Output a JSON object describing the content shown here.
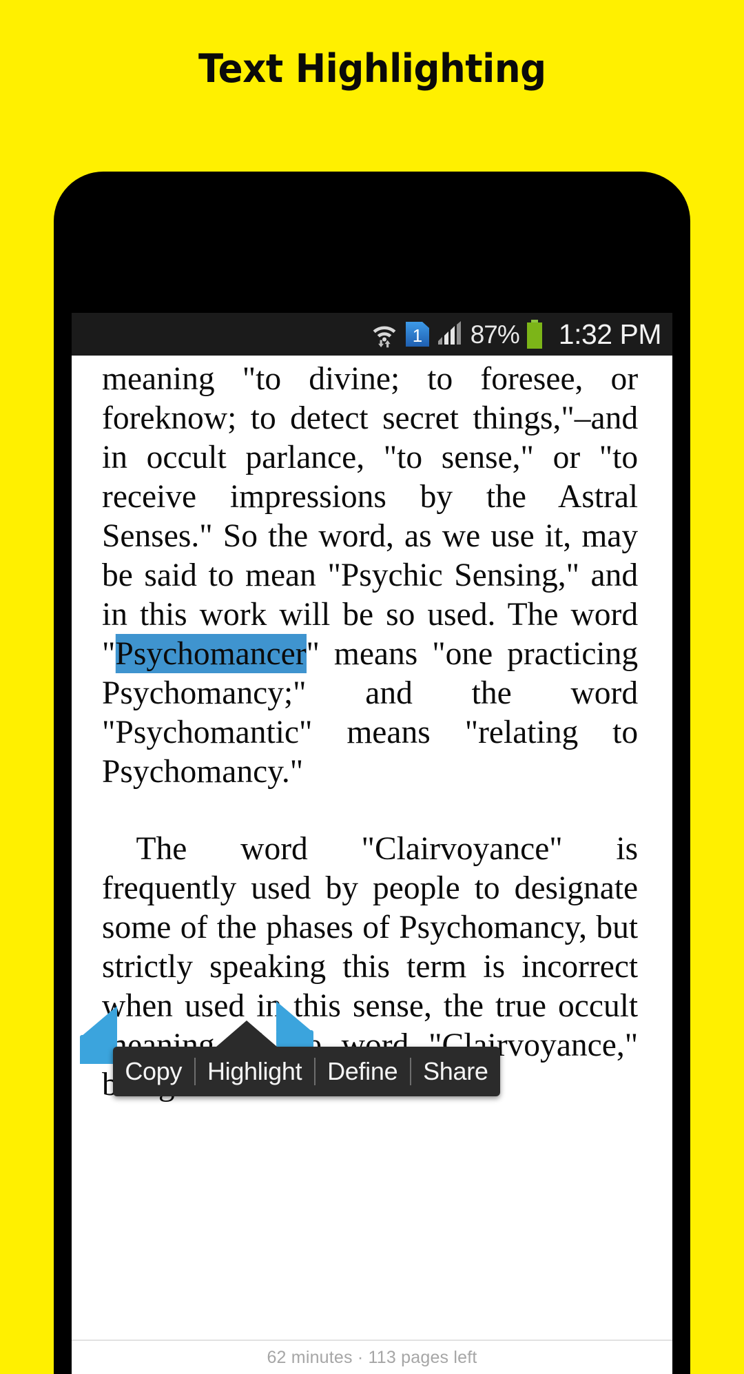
{
  "promo": {
    "title": "Text Highlighting",
    "background_color": "#FFF000",
    "title_color": "#0A0A0A"
  },
  "device": {
    "frame_color": "#000000",
    "screen_background": "#FFFFFF"
  },
  "status_bar": {
    "background_color": "#1B1B1B",
    "wifi_icon": "wifi-icon",
    "sim_icon": "sim-card-icon",
    "sim_label": "1",
    "sim_color": "#2E86DE",
    "signal_icon": "signal-bars-icon",
    "battery_percent": "87%",
    "battery_icon": "battery-icon",
    "battery_color": "#7CB518",
    "clock": "1:32 PM"
  },
  "reader": {
    "paragraph_1_part_1": "meaning \"to divine; to foresee, or foreknow; to detect secret things,\"–and in occult parlance, \"to sense,\" or \"to receive impressions by the Astral Senses.\" So the word, as we use it, may be said to mean \"Psychic Sensing,\" and in this work will be so used. The word \"",
    "selected_text": "Psychomancer",
    "paragraph_1_part_2": "\" means \"one practicing Psychomancy;\" and the word \"Psychomantic\" means \"relating to Psychomancy.\"",
    "paragraph_2": "The word \"Clairvoyance\" is frequently used by people to designate some of the phases of Psychomancy, but strictly speaking this term is incorrect when used in this sense, the true occult meaning of the word \"Clairvoyance,\" being",
    "selection_highlight_color": "#3F94CF",
    "selection_handle_color": "#3BA4DD",
    "left_handle_icon": "selection-handle-left-icon",
    "right_handle_icon": "selection-handle-right-icon",
    "footer_status": "62 minutes · 113 pages left"
  },
  "context_menu": {
    "background_color": "#2B2B2B",
    "items": [
      {
        "label": "Copy",
        "name": "copy"
      },
      {
        "label": "Highlight",
        "name": "highlight"
      },
      {
        "label": "Define",
        "name": "define"
      },
      {
        "label": "Share",
        "name": "share"
      }
    ]
  }
}
